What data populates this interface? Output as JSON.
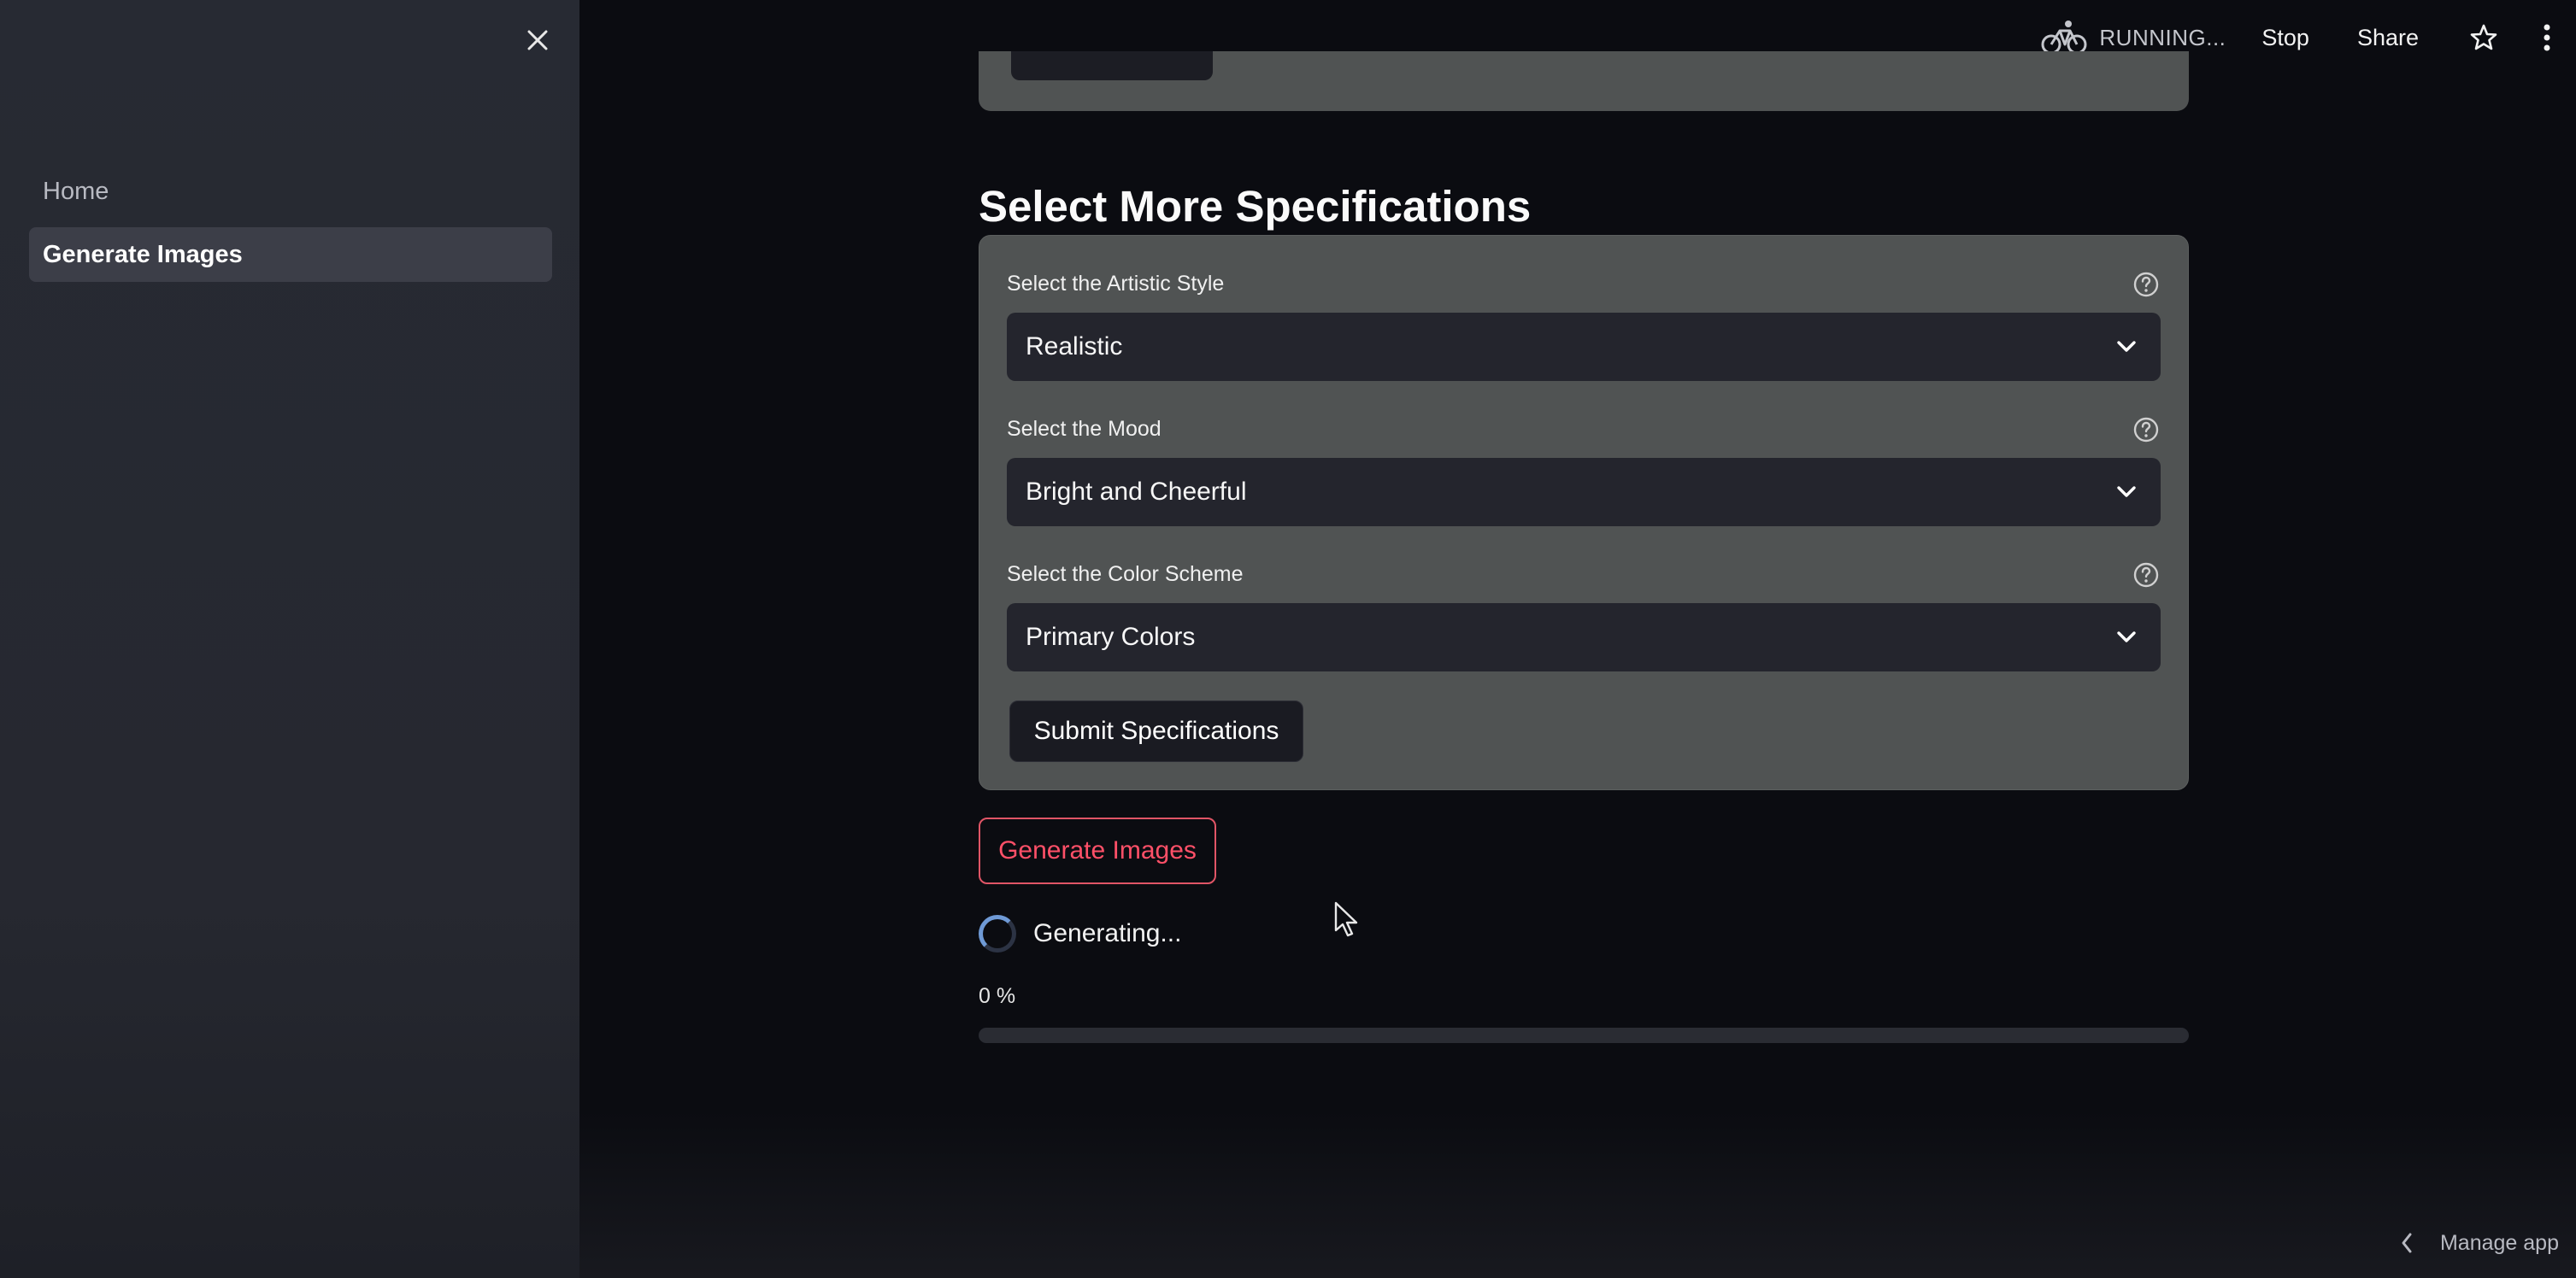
{
  "sidebar": {
    "items": [
      {
        "label": "Home",
        "active": false
      },
      {
        "label": "Generate Images",
        "active": true
      }
    ]
  },
  "header": {
    "status": "RUNNING...",
    "stop_label": "Stop",
    "share_label": "Share"
  },
  "main": {
    "section_title": "Select More Specifications",
    "fields": [
      {
        "label": "Select the Artistic Style",
        "value": "Realistic"
      },
      {
        "label": "Select the Mood",
        "value": "Bright and Cheerful"
      },
      {
        "label": "Select the Color Scheme",
        "value": "Primary Colors"
      }
    ],
    "submit_label": "Submit Specifications",
    "generate_label": "Generate Images",
    "status_text": "Generating...",
    "progress_text": "0 %",
    "progress": 0
  },
  "footer": {
    "manage_app_label": "Manage app"
  },
  "colors": {
    "accent": "#ff4b4b",
    "sidebar_bg": "#272a33",
    "main_bg": "#0b0c11",
    "form_bg": "#505353",
    "select_bg": "#24252d"
  }
}
